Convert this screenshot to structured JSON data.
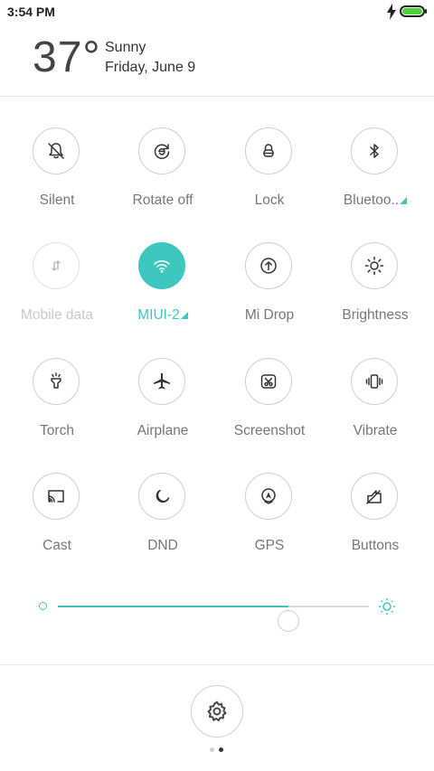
{
  "status_bar": {
    "time": "3:54 PM"
  },
  "weather": {
    "temperature": "37°",
    "condition": "Sunny",
    "date": "Friday, June 9"
  },
  "toggles": [
    {
      "label": "Silent",
      "icon": "bell-off-icon",
      "state": "off"
    },
    {
      "label": "Rotate off",
      "icon": "rotate-lock-icon",
      "state": "off"
    },
    {
      "label": "Lock",
      "icon": "lock-icon",
      "state": "off"
    },
    {
      "label": "Bluetoo..",
      "icon": "bluetooth-icon",
      "state": "off"
    },
    {
      "label": "Mobile data",
      "icon": "mobile-data-icon",
      "state": "disabled"
    },
    {
      "label": "MIUI-2",
      "icon": "wifi-icon",
      "state": "on"
    },
    {
      "label": "Mi Drop",
      "icon": "mi-drop-icon",
      "state": "off"
    },
    {
      "label": "Brightness",
      "icon": "brightness-icon",
      "state": "off"
    },
    {
      "label": "Torch",
      "icon": "torch-icon",
      "state": "off"
    },
    {
      "label": "Airplane",
      "icon": "airplane-icon",
      "state": "off"
    },
    {
      "label": "Screenshot",
      "icon": "screenshot-icon",
      "state": "off"
    },
    {
      "label": "Vibrate",
      "icon": "vibrate-icon",
      "state": "off"
    },
    {
      "label": "Cast",
      "icon": "cast-icon",
      "state": "off"
    },
    {
      "label": "DND",
      "icon": "moon-icon",
      "state": "off"
    },
    {
      "label": "GPS",
      "icon": "gps-icon",
      "state": "off"
    },
    {
      "label": "Buttons",
      "icon": "buttons-icon",
      "state": "off"
    }
  ],
  "brightness": {
    "level": 0.74
  },
  "pager": {
    "pages": 2,
    "current": 2
  },
  "colors": {
    "accent": "#3ec7be",
    "battery": "#4cd137"
  }
}
